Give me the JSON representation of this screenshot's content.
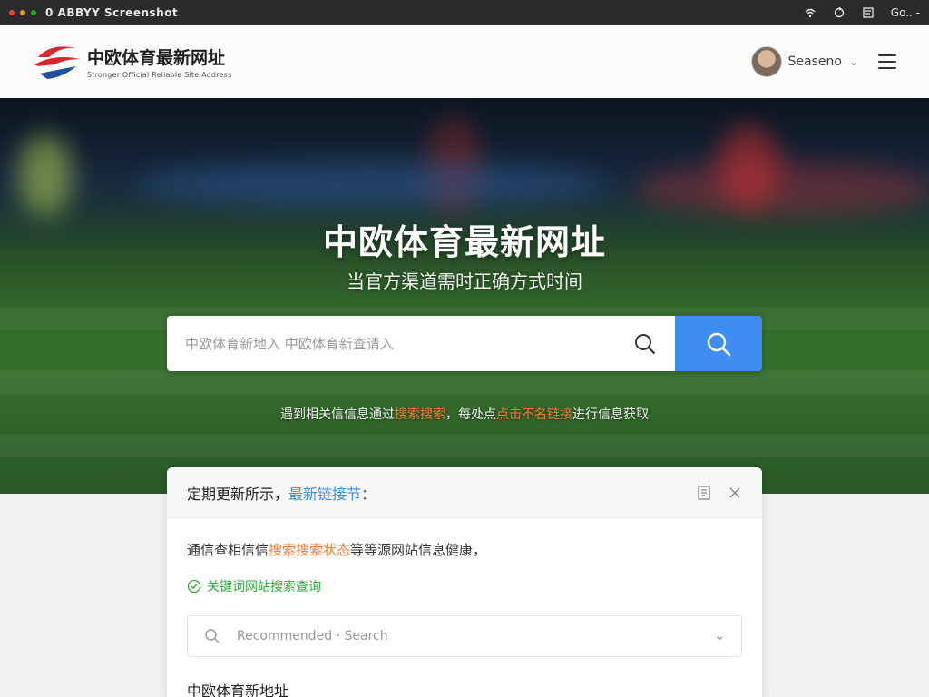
{
  "os_bar": {
    "title": "0 ABBYY Screenshot",
    "clock": "Go.. -",
    "dot_colors": [
      "#e0443e",
      "#dea123",
      "#1aab29"
    ]
  },
  "header": {
    "brand_title": "中欧体育最新网址",
    "brand_sub": "Stronger Official Reliable Site Address",
    "user_name": "Seaseno"
  },
  "hero": {
    "title": "中欧体育最新网址",
    "subtitle": "当官方渠道需时正确方式时间",
    "search_placeholder": "中欧体育新地入 中欧体育新查请入",
    "hint_pre": "遇到相关信信息通过",
    "hint_hl1": "搜索搜索",
    "hint_mid": "，每处点",
    "hint_hl2": "点击不名链接",
    "hint_post": "进行信息获取"
  },
  "card": {
    "title_main": "定期更新所示，",
    "title_blue": "最新链接节",
    "title_colon": "：",
    "line1_pre": "通信查相信信",
    "line1_hl": "搜索搜索状态",
    "line1_post": "等等源网站信息健康，",
    "line2": "关键词网站搜索查询",
    "select_text": "Recommended · Search",
    "section_title": "中欧体育新地址"
  },
  "colors": {
    "accent": "#3d8ef0",
    "highlight": "#ff7a2e",
    "success": "#2faa3a"
  }
}
